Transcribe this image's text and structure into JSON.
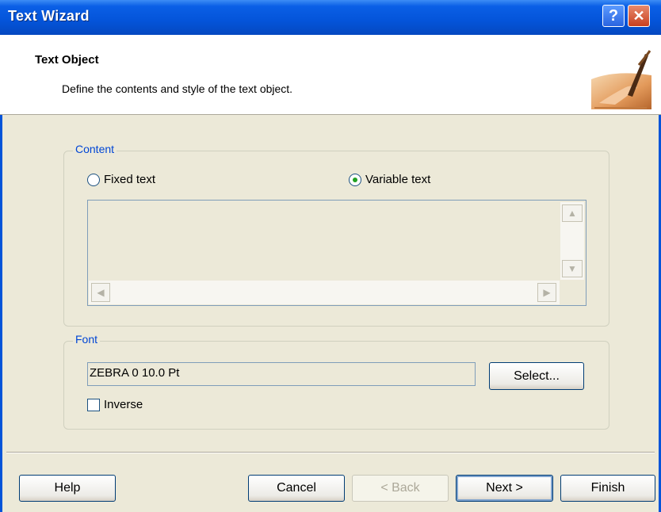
{
  "window": {
    "title": "Text Wizard"
  },
  "titlebar_buttons": {
    "help_glyph": "?",
    "close_glyph": "✕"
  },
  "header": {
    "title": "Text Object",
    "subtitle": "Define the contents and style of the text object."
  },
  "content_group": {
    "label": "Content",
    "options": [
      {
        "label": "Fixed text",
        "selected": false
      },
      {
        "label": "Variable text",
        "selected": true
      }
    ],
    "text_value": ""
  },
  "font_group": {
    "label": "Font",
    "font_value": "ZEBRA 0 10.0 Pt",
    "select_label": "Select...",
    "inverse_label": "Inverse",
    "inverse_checked": false
  },
  "buttons": {
    "help": "Help",
    "cancel": "Cancel",
    "back": "< Back",
    "next": "Next >",
    "finish": "Finish"
  },
  "icons": {
    "header_image": "hand-writing-quill-icon",
    "scroll_up": "▲",
    "scroll_down": "▼",
    "scroll_left": "◀",
    "scroll_right": "▶"
  },
  "colors": {
    "titlebar": "#0454D9",
    "group_label": "#0046D5",
    "radio_dot": "#21A121"
  }
}
